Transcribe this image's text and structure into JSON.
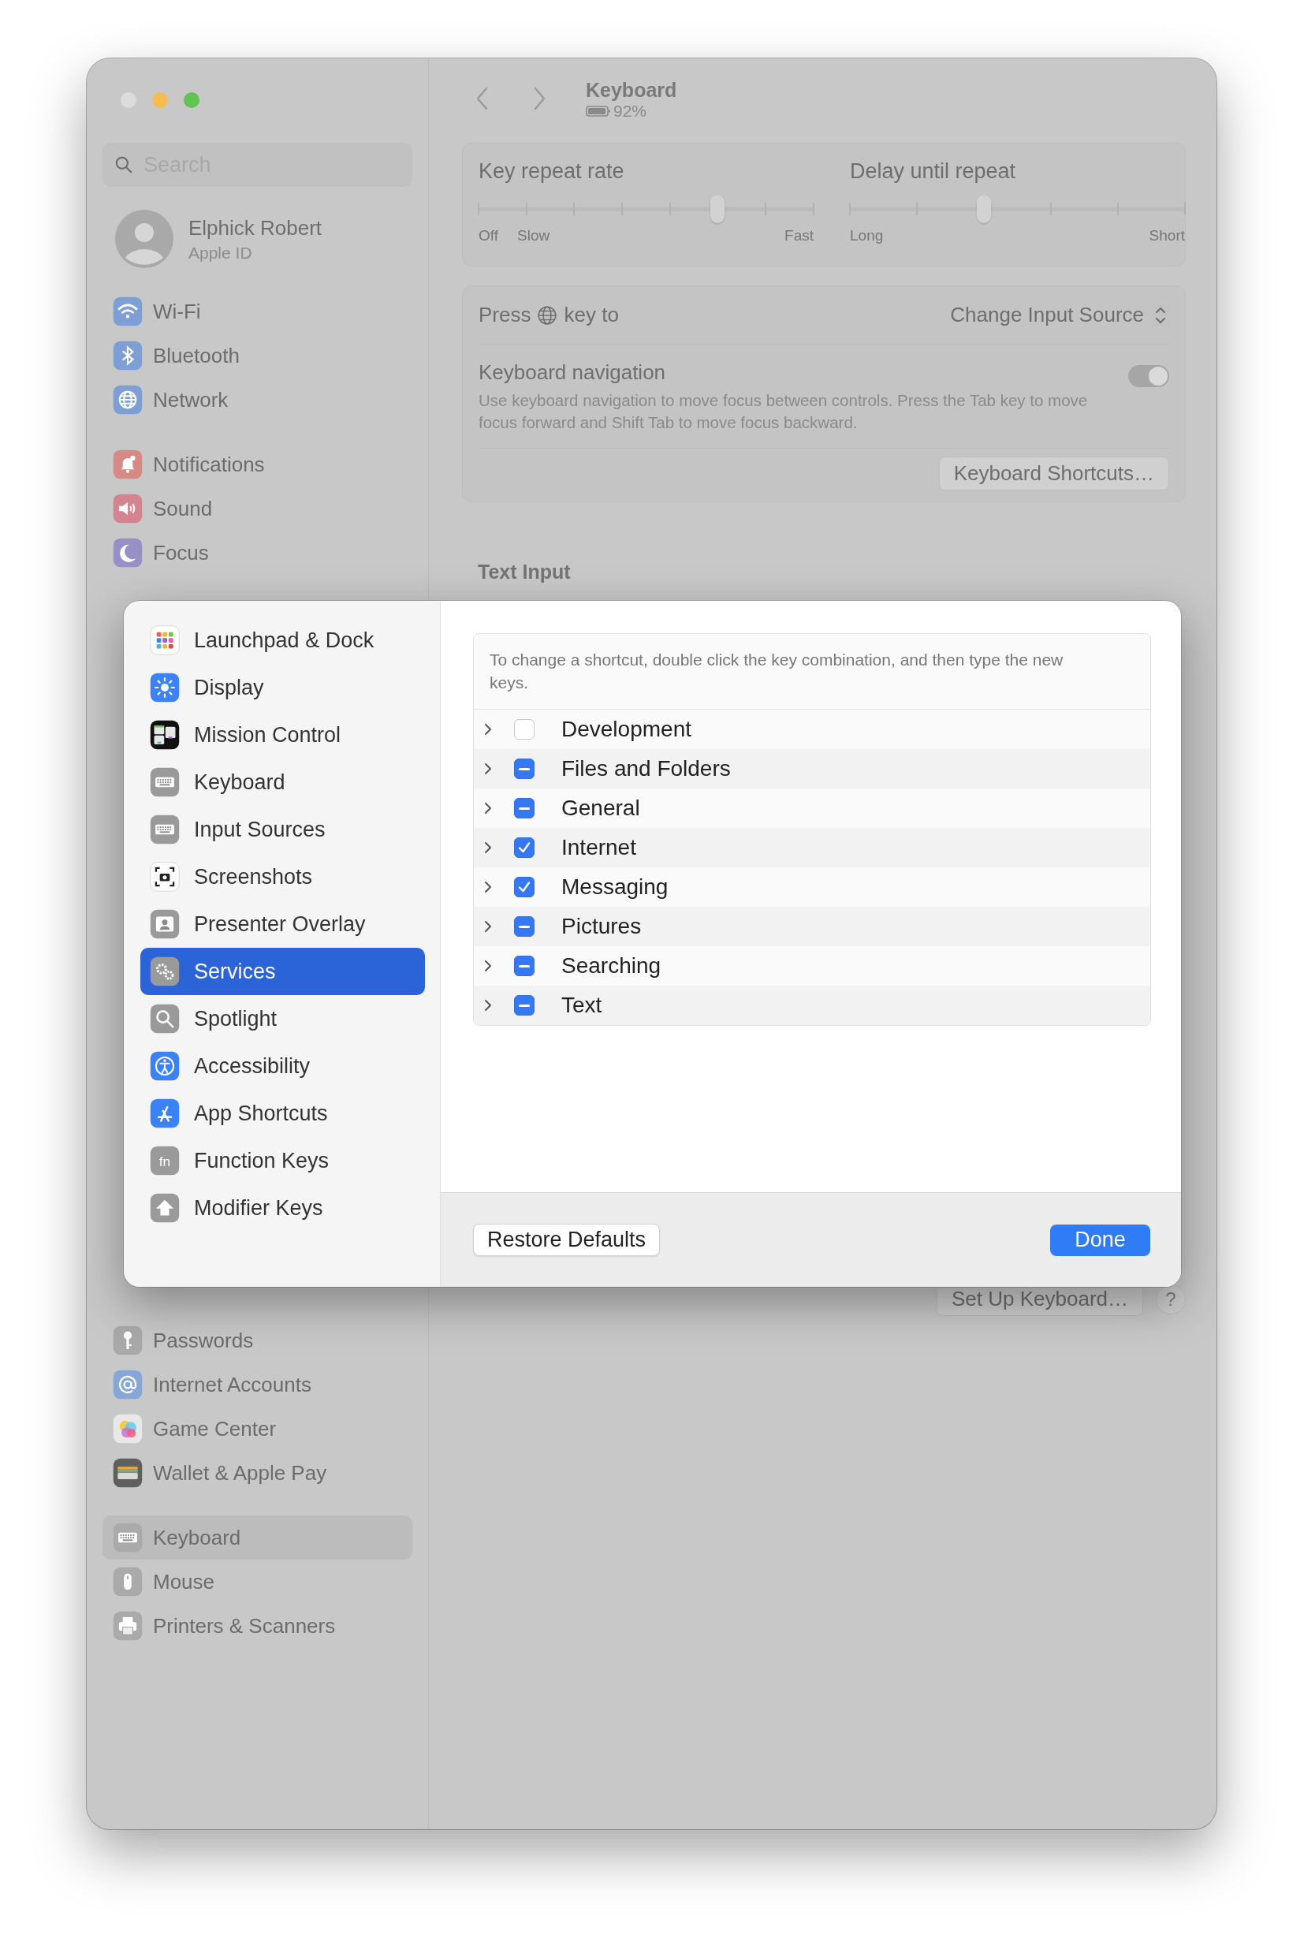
{
  "sidebar": {
    "search": {
      "placeholder": "Search"
    },
    "account": {
      "name": "Elphick Robert",
      "subtitle": "Apple ID"
    },
    "groups": [
      {
        "items": [
          {
            "label": "Wi-Fi",
            "selected": false
          },
          {
            "label": "Bluetooth",
            "selected": false
          },
          {
            "label": "Network",
            "selected": false
          }
        ]
      },
      {
        "items": [
          {
            "label": "Notifications",
            "selected": false
          },
          {
            "label": "Sound",
            "selected": false
          },
          {
            "label": "Focus",
            "selected": false
          }
        ]
      },
      {
        "items": [
          {
            "label": "Passwords",
            "selected": false
          },
          {
            "label": "Internet Accounts",
            "selected": false
          },
          {
            "label": "Game Center",
            "selected": false
          },
          {
            "label": "Wallet & Apple Pay",
            "selected": false
          }
        ]
      },
      {
        "items": [
          {
            "label": "Keyboard",
            "selected": true
          },
          {
            "label": "Mouse",
            "selected": false
          },
          {
            "label": "Printers & Scanners",
            "selected": false
          }
        ]
      }
    ]
  },
  "header": {
    "title": "Keyboard",
    "battery": "92%"
  },
  "sliders": [
    {
      "label": "Key repeat rate",
      "level": 0.714,
      "labels": [
        {
          "text": "Off",
          "kind": "start"
        },
        {
          "text": "Slow",
          "kind": "start"
        },
        {
          "text": "Fast",
          "kind": "end"
        }
      ]
    },
    {
      "label": "Delay until repeat",
      "level": 0.4,
      "labels": [
        {
          "text": "Long",
          "kind": "start"
        },
        {
          "text": "Short",
          "kind": "end"
        }
      ]
    }
  ],
  "press_key": {
    "prefix": "Press",
    "suffix": "key to",
    "value": "Change Input Source"
  },
  "keyboard_navigation": {
    "title": "Keyboard navigation",
    "description": "Use keyboard navigation to move focus between controls. Press the Tab key to move focus forward and Shift Tab to move focus backward.",
    "on": true
  },
  "shortcuts_button": "Keyboard Shortcuts…",
  "text_input": {
    "heading": "Text Input",
    "setup_button": "Set Up Keyboard…",
    "help": "?"
  },
  "dialog": {
    "categories": [
      {
        "label": "Launchpad & Dock",
        "selected": false
      },
      {
        "label": "Display",
        "selected": false
      },
      {
        "label": "Mission Control",
        "selected": false
      },
      {
        "label": "Keyboard",
        "selected": false
      },
      {
        "label": "Input Sources",
        "selected": false
      },
      {
        "label": "Screenshots",
        "selected": false
      },
      {
        "label": "Presenter Overlay",
        "selected": false
      },
      {
        "label": "Services",
        "selected": true
      },
      {
        "label": "Spotlight",
        "selected": false
      },
      {
        "label": "Accessibility",
        "selected": false
      },
      {
        "label": "App Shortcuts",
        "selected": false
      },
      {
        "label": "Function Keys",
        "selected": false,
        "icon_text": "fn"
      },
      {
        "label": "Modifier Keys",
        "selected": false
      }
    ],
    "hint": "To change a shortcut, double click the key combination, and then type the new keys.",
    "rows": [
      {
        "label": "Development",
        "kind": "checkbox",
        "checked": false,
        "expanded": false
      },
      {
        "label": "Files and Folders",
        "kind": "mixed",
        "checked": true,
        "expanded": false
      },
      {
        "label": "General",
        "kind": "mixed",
        "checked": true,
        "expanded": false
      },
      {
        "label": "Internet",
        "kind": "checkbox",
        "checked": true,
        "expanded": false
      },
      {
        "label": "Messaging",
        "kind": "checkbox",
        "checked": true,
        "expanded": false
      },
      {
        "label": "Pictures",
        "kind": "mixed",
        "checked": true,
        "expanded": false
      },
      {
        "label": "Searching",
        "kind": "mixed",
        "checked": true,
        "expanded": false
      },
      {
        "label": "Text",
        "kind": "mixed",
        "checked": true,
        "expanded": false
      }
    ],
    "restore_button": "Restore Defaults",
    "done_button": "Done"
  }
}
